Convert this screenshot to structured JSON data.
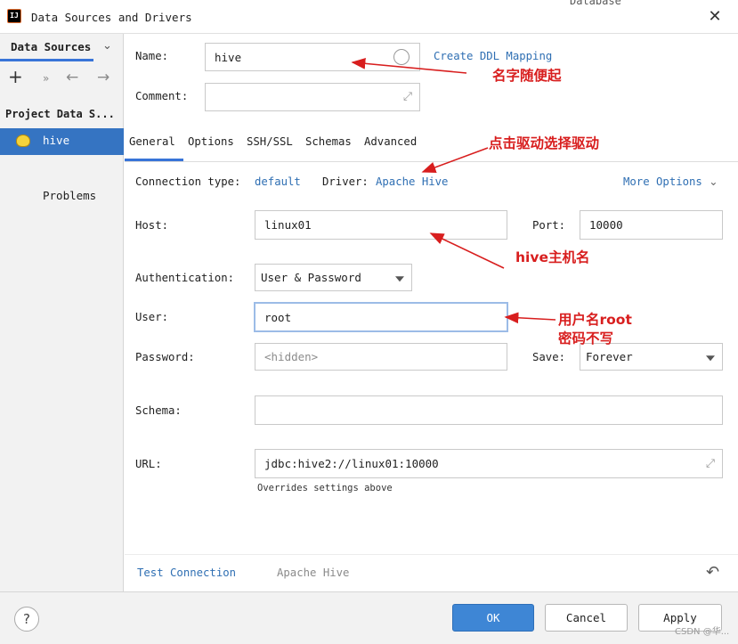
{
  "window": {
    "title": "Data Sources and Drivers",
    "background_text": "Database",
    "app_icon_text": "IJ"
  },
  "sidebar": {
    "tab_label": "Data Sources",
    "section_title": "Project Data S...",
    "items": [
      {
        "label": "hive",
        "selected": true
      }
    ],
    "problems_label": "Problems"
  },
  "form": {
    "name_label": "Name:",
    "name_value": "hive",
    "ddl_link": "Create DDL Mapping",
    "comment_label": "Comment:",
    "comment_value": ""
  },
  "tabs": [
    {
      "label": "General",
      "active": true
    },
    {
      "label": "Options",
      "active": false
    },
    {
      "label": "SSH/SSL",
      "active": false
    },
    {
      "label": "Schemas",
      "active": false
    },
    {
      "label": "Advanced",
      "active": false
    }
  ],
  "general": {
    "connection_type_label": "Connection type:",
    "connection_type_value": "default",
    "driver_label": "Driver:",
    "driver_value": "Apache Hive",
    "more_options": "More Options",
    "host_label": "Host:",
    "host_value": "linux01",
    "port_label": "Port:",
    "port_value": "10000",
    "auth_label": "Authentication:",
    "auth_value": "User & Password",
    "user_label": "User:",
    "user_value": "root",
    "password_label": "Password:",
    "password_placeholder": "<hidden>",
    "save_label": "Save:",
    "save_value": "Forever",
    "schema_label": "Schema:",
    "schema_value": "",
    "url_label": "URL:",
    "url_value": "jdbc:hive2://linux01:10000",
    "url_hint": "Overrides settings above"
  },
  "bottom": {
    "test_connection": "Test Connection",
    "driver_status": "Apache Hive"
  },
  "buttons": {
    "ok": "OK",
    "cancel": "Cancel",
    "apply": "Apply",
    "help": "?"
  },
  "annotations": {
    "name_note": "名字随便起",
    "driver_note": "点击驱动选择驱动",
    "host_note": "hive主机名",
    "user_note_1": "用户名root",
    "user_note_2": "密码不写"
  },
  "watermark": "CSDN @华...",
  "colors": {
    "accent": "#3874d8",
    "link": "#2f6fb3",
    "selection": "#3574c2",
    "annotation": "#d81e1e"
  },
  "icons": {
    "close": "close-icon",
    "add": "plus-icon",
    "back": "arrow-left-icon",
    "forward": "arrow-right-icon",
    "expand": "expand-icon",
    "undo": "undo-icon"
  }
}
